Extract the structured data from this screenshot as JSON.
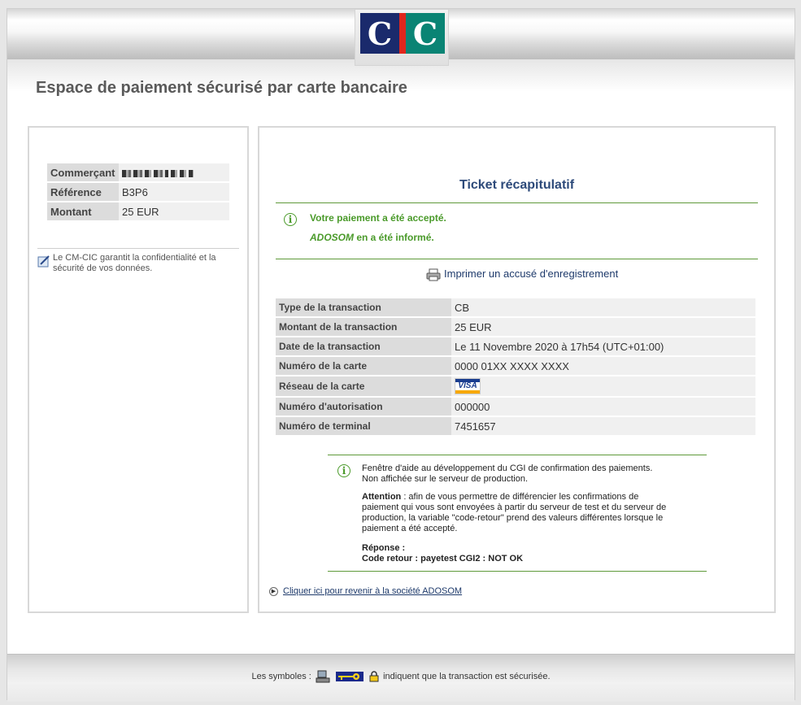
{
  "header": {
    "logo_text": "CIC",
    "page_title": "Espace de paiement sécurisé par carte bancaire"
  },
  "left": {
    "rows": [
      {
        "label": "Commerçant",
        "value": ""
      },
      {
        "label": "Référence",
        "value": "B3P6"
      },
      {
        "label": "Montant",
        "value": "25 EUR"
      }
    ],
    "secure_note": "Le CM-CIC garantit la confidentialité et la sécurité de vos données."
  },
  "ticket": {
    "title": "Ticket récapitulatif",
    "accepted": "Votre paiement a été accepté.",
    "merchant_name": "ADOSOM",
    "informed_suffix": " en a été informé.",
    "print_label": "Imprimer un accusé d'enregistrement",
    "rows": [
      {
        "label": "Type de la transaction",
        "value": "CB"
      },
      {
        "label": "Montant de la transaction",
        "value": "25 EUR"
      },
      {
        "label": "Date de la transaction",
        "value": "Le 11 Novembre 2020 à 17h54 (UTC+01:00)"
      },
      {
        "label": "Numéro de la carte",
        "value": "0000 01XX XXXX XXXX"
      },
      {
        "label": "Réseau de la carte",
        "value": "VISA"
      },
      {
        "label": "Numéro d'autorisation",
        "value": "000000"
      },
      {
        "label": "Numéro de terminal",
        "value": "7451657"
      }
    ]
  },
  "help": {
    "intro": "Fenêtre d'aide au développement du CGI de confirmation des paiements. Non affichée sur le serveur de production.",
    "attention_label": "Attention",
    "attention_text": " : afin de vous permettre de différencier les confirmations de paiement qui vous sont envoyées à partir du serveur de test et du serveur de production, la variable \"code-retour\" prend des valeurs différentes lorsque le paiement a été accepté.",
    "response_label": "Réponse :",
    "code_retour": "Code retour : payetest CGI2 : NOT OK"
  },
  "back_link": "Cliquer ici pour revenir à la société ADOSOM",
  "footer": {
    "prefix": "Les symboles :",
    "suffix": "indiquent que la transaction est sécurisée."
  },
  "colors": {
    "title_blue": "#2d4a7a",
    "success_green": "#4a9a2a",
    "cic_blue": "#1a2a6c",
    "cic_red": "#e1261c",
    "cic_teal": "#0a8474"
  }
}
